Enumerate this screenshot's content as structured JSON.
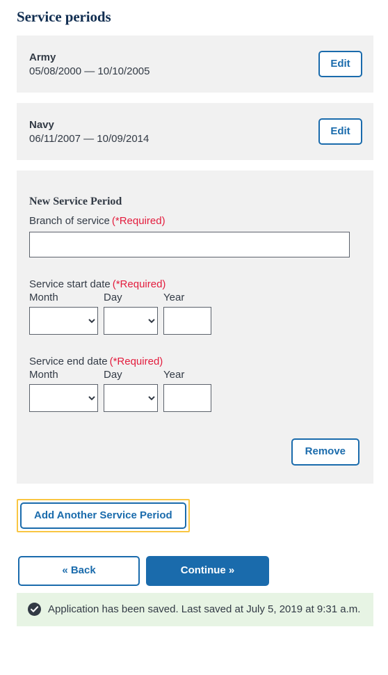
{
  "page": {
    "heading": "Service periods"
  },
  "service_periods": [
    {
      "branch": "Army",
      "dates": "05/08/2000 — 10/10/2005",
      "edit_label": "Edit"
    },
    {
      "branch": "Navy",
      "dates": "06/11/2007 — 10/09/2014",
      "edit_label": "Edit"
    }
  ],
  "new_period_form": {
    "title": "New Service Period",
    "branch_field": {
      "label": "Branch of service",
      "required_flag": "(*Required)",
      "value": "",
      "placeholder": ""
    },
    "start_date": {
      "legend": "Service start date",
      "required_flag": "(*Required)",
      "month_label": "Month",
      "day_label": "Day",
      "year_label": "Year",
      "month_value": "",
      "day_value": "",
      "year_value": ""
    },
    "end_date": {
      "legend": "Service end date",
      "required_flag": "(*Required)",
      "month_label": "Month",
      "day_label": "Day",
      "year_label": "Year",
      "month_value": "",
      "day_value": "",
      "year_value": ""
    },
    "remove_label": "Remove"
  },
  "actions": {
    "add_another_label": "Add Another Service Period",
    "back_label": "« Back",
    "continue_label": "Continue »"
  },
  "saved_banner": {
    "icon": "check-circle-icon",
    "message": "Application has been saved. Last saved at July 5, 2019 at 9:31 a.m."
  },
  "colors": {
    "heading_navy": "#112e51",
    "link_blue": "#1a6bac",
    "required_red": "#e31c3d",
    "panel_gray": "#f1f1f1",
    "banner_green": "#e7f4e4",
    "focus_gold": "#f9c642",
    "input_border": "#5b616b",
    "text": "#323a45"
  }
}
